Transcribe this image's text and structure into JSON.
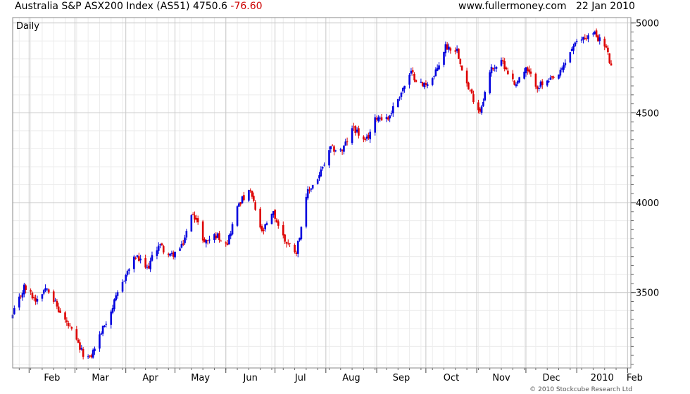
{
  "header": {
    "title": "Australia S&P ASX200 Index (AS51) 4750.6",
    "change": "-76.60",
    "site": "www.fullermoney.com",
    "date": "22 Jan 2010"
  },
  "footer": {
    "copyright": "© 2010 Stockcube Research Ltd"
  },
  "colors": {
    "up": "#0000dd",
    "down": "#dd0000",
    "grid_major": "#c8c8c8",
    "grid_minor": "#ececec"
  },
  "chart_data": {
    "type": "candlestick",
    "period_label": "Daily",
    "ylim": [
      3080,
      5030
    ],
    "yticks": [
      3500,
      4000,
      4500,
      5000
    ],
    "ytick_labels": [
      "3500",
      "4000",
      "4500",
      "5000"
    ],
    "grid": true,
    "x_axis": {
      "start": "2009-01-22",
      "end": "2010-02-03",
      "month_labels": [
        {
          "label": "Feb",
          "date": "2009-02-01"
        },
        {
          "label": "Mar",
          "date": "2009-03-01"
        },
        {
          "label": "Apr",
          "date": "2009-04-01"
        },
        {
          "label": "May",
          "date": "2009-05-01"
        },
        {
          "label": "Jun",
          "date": "2009-06-01"
        },
        {
          "label": "Jul",
          "date": "2009-07-01"
        },
        {
          "label": "Aug",
          "date": "2009-08-01"
        },
        {
          "label": "Sep",
          "date": "2009-09-01"
        },
        {
          "label": "Oct",
          "date": "2009-10-01"
        },
        {
          "label": "Nov",
          "date": "2009-11-01"
        },
        {
          "label": "Dec",
          "date": "2009-12-01"
        },
        {
          "label": "2010",
          "date": "2010-01-01"
        },
        {
          "label": "Feb",
          "date": "2010-02-01"
        }
      ]
    },
    "close_path": [
      [
        "2009-01-22",
        3370
      ],
      [
        "2009-01-29",
        3530
      ],
      [
        "2009-02-05",
        3460
      ],
      [
        "2009-02-12",
        3540
      ],
      [
        "2009-02-19",
        3400
      ],
      [
        "2009-02-26",
        3300
      ],
      [
        "2009-03-05",
        3170
      ],
      [
        "2009-03-10",
        3130
      ],
      [
        "2009-03-17",
        3280
      ],
      [
        "2009-03-24",
        3420
      ],
      [
        "2009-03-31",
        3580
      ],
      [
        "2009-04-07",
        3700
      ],
      [
        "2009-04-14",
        3630
      ],
      [
        "2009-04-21",
        3770
      ],
      [
        "2009-04-28",
        3700
      ],
      [
        "2009-05-05",
        3750
      ],
      [
        "2009-05-12",
        3950
      ],
      [
        "2009-05-19",
        3780
      ],
      [
        "2009-05-26",
        3820
      ],
      [
        "2009-06-02",
        3780
      ],
      [
        "2009-06-09",
        4000
      ],
      [
        "2009-06-16",
        4060
      ],
      [
        "2009-06-23",
        3830
      ],
      [
        "2009-06-30",
        3940
      ],
      [
        "2009-07-07",
        3790
      ],
      [
        "2009-07-14",
        3730
      ],
      [
        "2009-07-21",
        4060
      ],
      [
        "2009-07-28",
        4150
      ],
      [
        "2009-08-04",
        4300
      ],
      [
        "2009-08-11",
        4290
      ],
      [
        "2009-08-18",
        4420
      ],
      [
        "2009-08-25",
        4330
      ],
      [
        "2009-09-01",
        4480
      ],
      [
        "2009-09-08",
        4470
      ],
      [
        "2009-09-15",
        4600
      ],
      [
        "2009-09-22",
        4720
      ],
      [
        "2009-09-29",
        4650
      ],
      [
        "2009-10-06",
        4700
      ],
      [
        "2009-10-13",
        4870
      ],
      [
        "2009-10-20",
        4850
      ],
      [
        "2009-10-27",
        4630
      ],
      [
        "2009-11-03",
        4510
      ],
      [
        "2009-11-10",
        4750
      ],
      [
        "2009-11-17",
        4780
      ],
      [
        "2009-11-24",
        4660
      ],
      [
        "2009-12-01",
        4740
      ],
      [
        "2009-12-08",
        4650
      ],
      [
        "2009-12-15",
        4670
      ],
      [
        "2009-12-22",
        4720
      ],
      [
        "2009-12-29",
        4860
      ],
      [
        "2010-01-05",
        4920
      ],
      [
        "2010-01-12",
        4940
      ],
      [
        "2010-01-19",
        4860
      ],
      [
        "2010-01-22",
        4750
      ]
    ]
  }
}
